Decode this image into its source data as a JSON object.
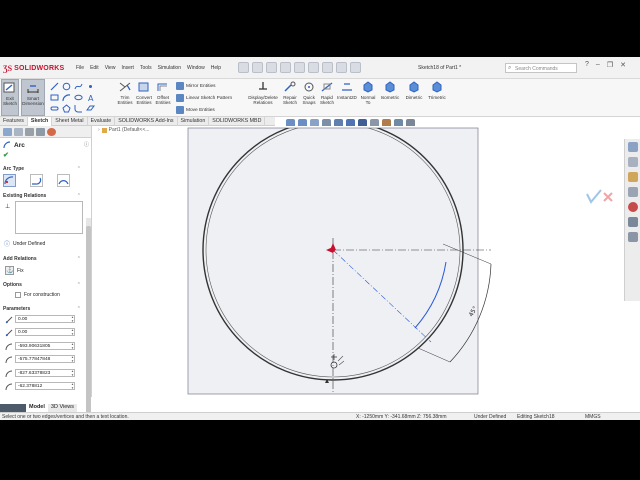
{
  "app": {
    "brand": "SOLIDWORKS",
    "doc_title": "Sketch18 of Part1 *"
  },
  "menu": [
    "File",
    "Edit",
    "View",
    "Insert",
    "Tools",
    "Simulation",
    "Window",
    "Help"
  ],
  "search": {
    "placeholder": "Search Commands"
  },
  "ribbon": {
    "exit_sketch": "Exit Sketch",
    "smart_dimension": "Smart Dimension",
    "trim": "Trim Entities",
    "convert": "Convert Entities",
    "offset": "Offset Entities",
    "mirror": "Mirror Entities",
    "linear_pattern": "Linear Sketch Pattern",
    "move": "Move Entities",
    "display_delete": "Display/Delete Relations",
    "repair": "Repair Sketch",
    "quick_snaps": "Quick Snaps",
    "rapid_sketch": "Rapid Sketch",
    "instant2d": "Instant2D",
    "normal_to": "Normal To",
    "isometric": "Isometric",
    "dimetric": "Dimetric",
    "trimetric": "Trimetric"
  },
  "tabs": [
    {
      "label": "Features"
    },
    {
      "label": "Sketch",
      "active": true
    },
    {
      "label": "Sheet Metal"
    },
    {
      "label": "Evaluate"
    },
    {
      "label": "SOLIDWORKS Add-Ins"
    },
    {
      "label": "Simulation"
    },
    {
      "label": "SOLIDWORKS MBD"
    }
  ],
  "tree": {
    "part": "Part1 (Default<<..."
  },
  "property_manager": {
    "title": "Arc",
    "arc_type": "Arc Type",
    "existing_relations": "Existing Relations",
    "status": "Under Defined",
    "add_relations": "Add Relations",
    "fix": "Fix",
    "options": "Options",
    "for_construction": "For construction",
    "parameters": "Parameters",
    "values": [
      "0.00",
      "0.00",
      "-593.90631805",
      "-575.77847848",
      "-827.63378823",
      "-62.378812"
    ]
  },
  "bottom_tabs": [
    "Model",
    "3D Views"
  ],
  "status_bar": {
    "hint": "Select one or two edges/vertices and then a text location.",
    "coords": "X: -1250mm Y: -341.68mm Z: 756.38mm",
    "defined": "Under Defined",
    "editing": "Editing Sketch18",
    "units": "MMGS"
  },
  "colors": {
    "accent": "#2f62c4",
    "brand": "#c8102e",
    "sketch_blue": "#2a5bd7"
  }
}
